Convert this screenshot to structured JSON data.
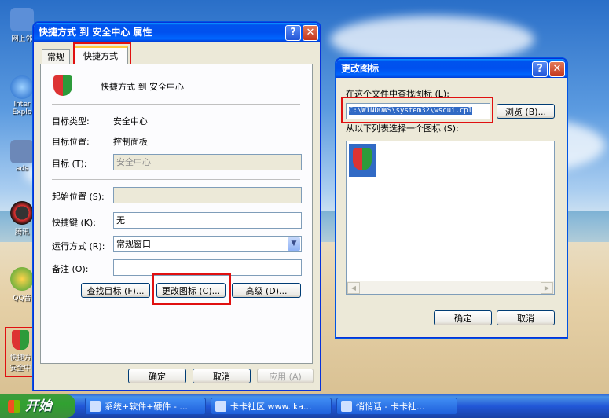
{
  "desktop": {
    "icons": [
      {
        "label": "网上邻",
        "icon": "network-icon"
      },
      {
        "label": "Inter Explo",
        "icon": "ie-icon"
      },
      {
        "label": "ads",
        "icon": "shortcut-icon"
      },
      {
        "label": "腾讯",
        "icon": "qq-icon"
      },
      {
        "label": "QQ音",
        "icon": "qqmusic-icon"
      },
      {
        "label": "快捷方 安全中",
        "icon": "shield-shortcut-icon"
      }
    ]
  },
  "props": {
    "title": "快捷方式 到 安全中心 属性",
    "tabs": [
      "常规",
      "快捷方式"
    ],
    "header_name": "快捷方式 到 安全中心",
    "rows": {
      "type_label": "目标类型:",
      "type_value": "安全中心",
      "loc_label": "目标位置:",
      "loc_value": "控制面板",
      "target_label": "目标 (T):",
      "target_value": "安全中心",
      "start_label": "起始位置 (S):",
      "start_value": "",
      "hotkey_label": "快捷键 (K):",
      "hotkey_value": "无",
      "run_label": "运行方式 (R):",
      "run_value": "常规窗口",
      "comment_label": "备注 (O):",
      "comment_value": ""
    },
    "buttons": {
      "find": "查找目标 (F)...",
      "change_icon": "更改图标 (C)...",
      "advanced": "高级 (D)...",
      "ok": "确定",
      "cancel": "取消",
      "apply": "应用 (A)"
    }
  },
  "change_icon": {
    "title": "更改图标",
    "search_label": "在这个文件中查找图标 (L):",
    "path_value": "C:\\WINDOWS\\system32\\wscui.cpl",
    "browse": "浏览 (B)...",
    "list_label": "从以下列表选择一个图标 (S):",
    "ok": "确定",
    "cancel": "取消"
  },
  "taskbar": {
    "start": "开始",
    "tasks": [
      "系统+软件+硬件 - ...",
      "卡卡社区 www.ika...",
      "悄悄话 - 卡卡社..."
    ]
  },
  "colors": {
    "highlight": "#e01010",
    "title_blue": "#0053ee",
    "start_green": "#31a131"
  }
}
